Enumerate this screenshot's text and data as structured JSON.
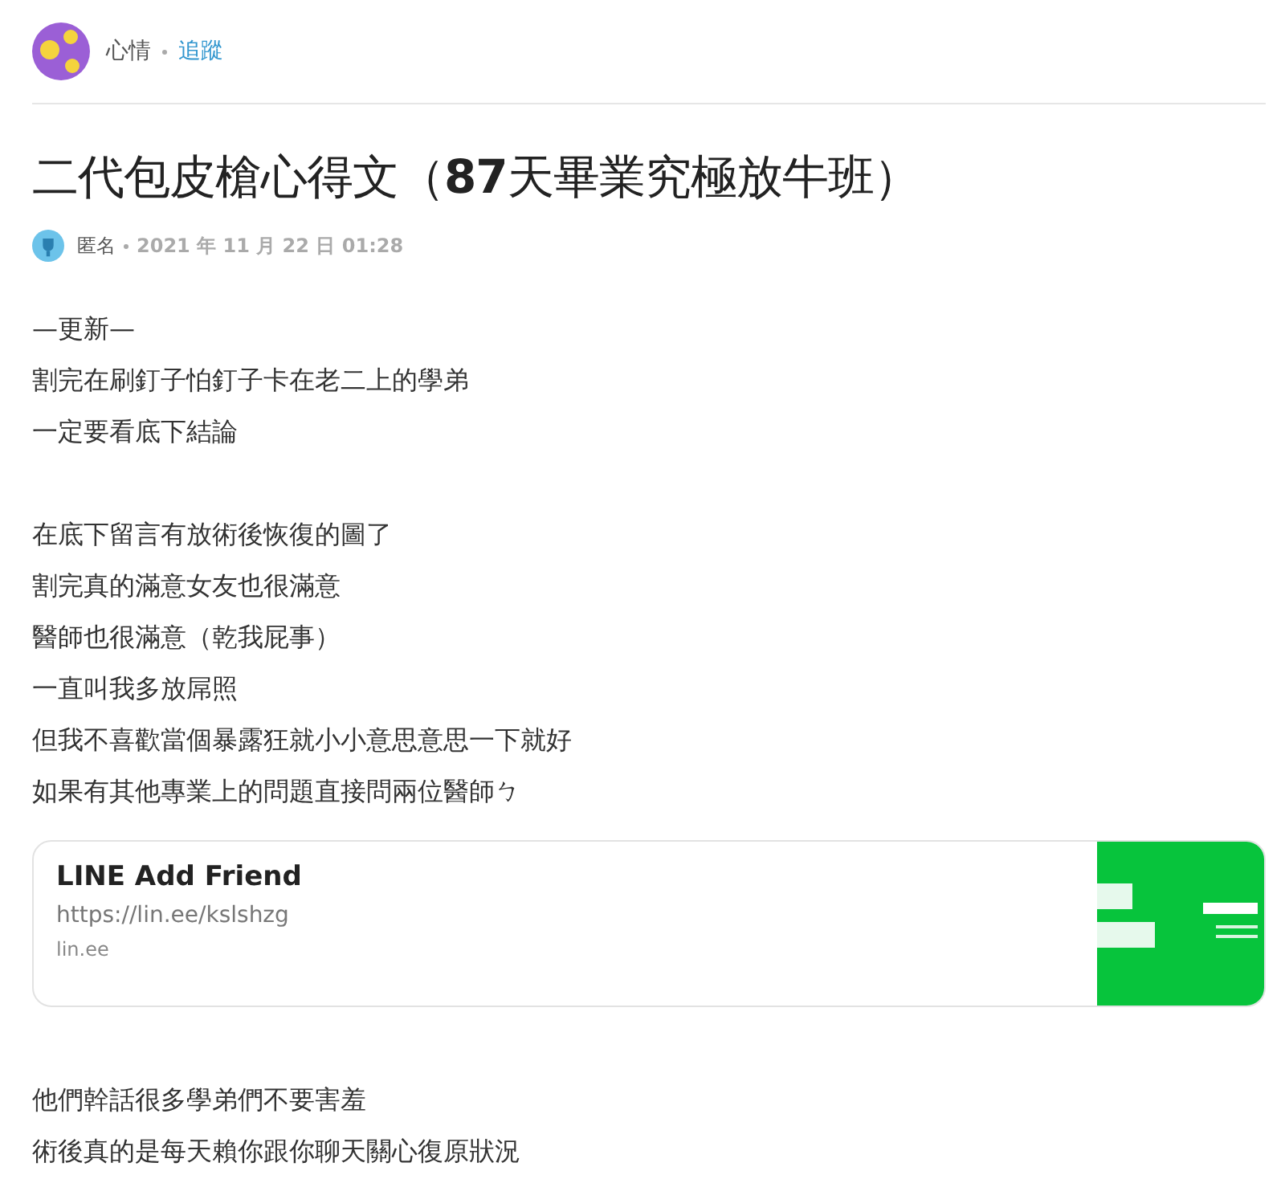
{
  "board": {
    "name": "心情",
    "follow": "追蹤"
  },
  "post": {
    "title": "二代包皮槍心得文（**87**天畢業究極放牛班）",
    "author": "匿名",
    "date": "2021 年 11 月 22 日 01:28"
  },
  "blocks": [
    {
      "kind": "text",
      "lines": [
        "—更新—",
        "割完在刷釘子怕釘子卡在老二上的學弟",
        "一定要看底下結論"
      ]
    },
    {
      "kind": "text",
      "lines": [
        "在底下留言有放術後恢復的圖了",
        "割完真的滿意女友也很滿意",
        "醫師也很滿意（乾我屁事）",
        "一直叫我多放屌照",
        "但我不喜歡當個暴露狂就小小意思意思一下就好",
        "如果有其他專業上的問題直接問兩位醫師ㄅ"
      ]
    },
    {
      "kind": "link_card",
      "title": "LINE Add Friend",
      "url": "https://lin.ee/kslshzg",
      "domain": "lin.ee"
    },
    {
      "kind": "text",
      "lines": [
        "他們幹話很多學弟們不要害羞",
        "術後真的是每天賴你跟你聊天關心復原狀況"
      ]
    }
  ]
}
